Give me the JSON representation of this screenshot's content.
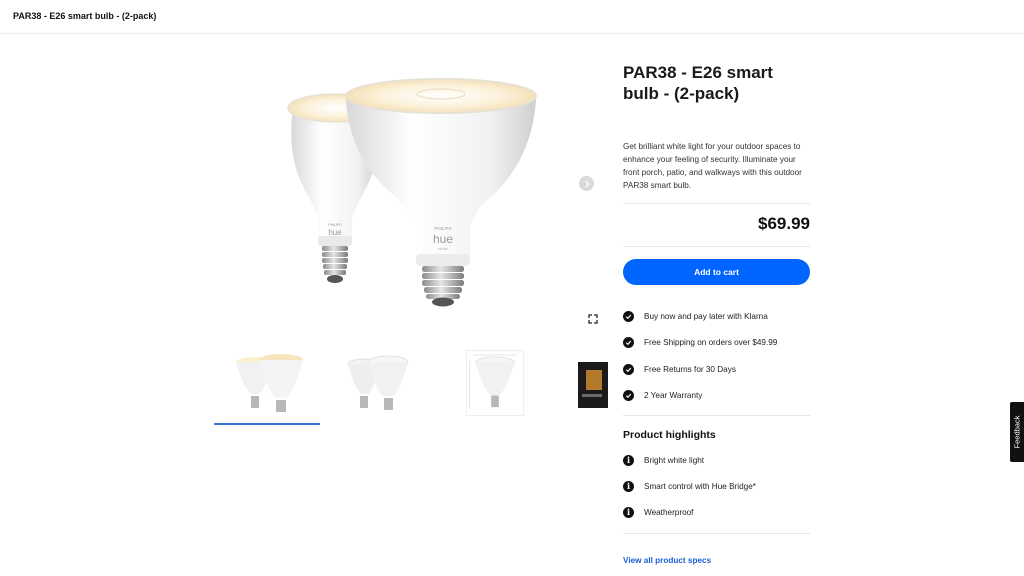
{
  "header": {
    "title": "PAR38 - E26 smart bulb - (2-pack)"
  },
  "gallery": {
    "next_icon": "chevron-right-icon",
    "expand_icon": "expand-icon",
    "bulb_brand": "PHILIPS",
    "bulb_logo": "hue",
    "bulb_sub": "white",
    "active_thumb": 1
  },
  "product": {
    "title": "PAR38 - E26 smart bulb - (2-pack)",
    "description": "Get brilliant white light for your outdoor spaces to enhance your feeling of security. Illuminate your front porch, patio, and walkways with this outdoor PAR38 smart bulb.",
    "price": "$69.99",
    "add_to_cart": "Add to cart",
    "accent_color": "#0064ff"
  },
  "perks": [
    {
      "icon": "check-circle-icon",
      "label": "Buy now and pay later with Klarna"
    },
    {
      "icon": "check-circle-icon",
      "label": "Free Shipping on orders over $49.99"
    },
    {
      "icon": "check-circle-icon",
      "label": "Free Returns for 30 Days"
    },
    {
      "icon": "check-circle-icon",
      "label": "2 Year Warranty"
    }
  ],
  "highlights": {
    "title": "Product highlights",
    "items": [
      {
        "icon": "info-icon",
        "label": "Bright white light"
      },
      {
        "icon": "info-icon",
        "label": "Smart control with Hue Bridge*"
      },
      {
        "icon": "info-icon",
        "label": "Weatherproof"
      }
    ]
  },
  "specs_link": "View all product specs",
  "feedback": "Feedback"
}
